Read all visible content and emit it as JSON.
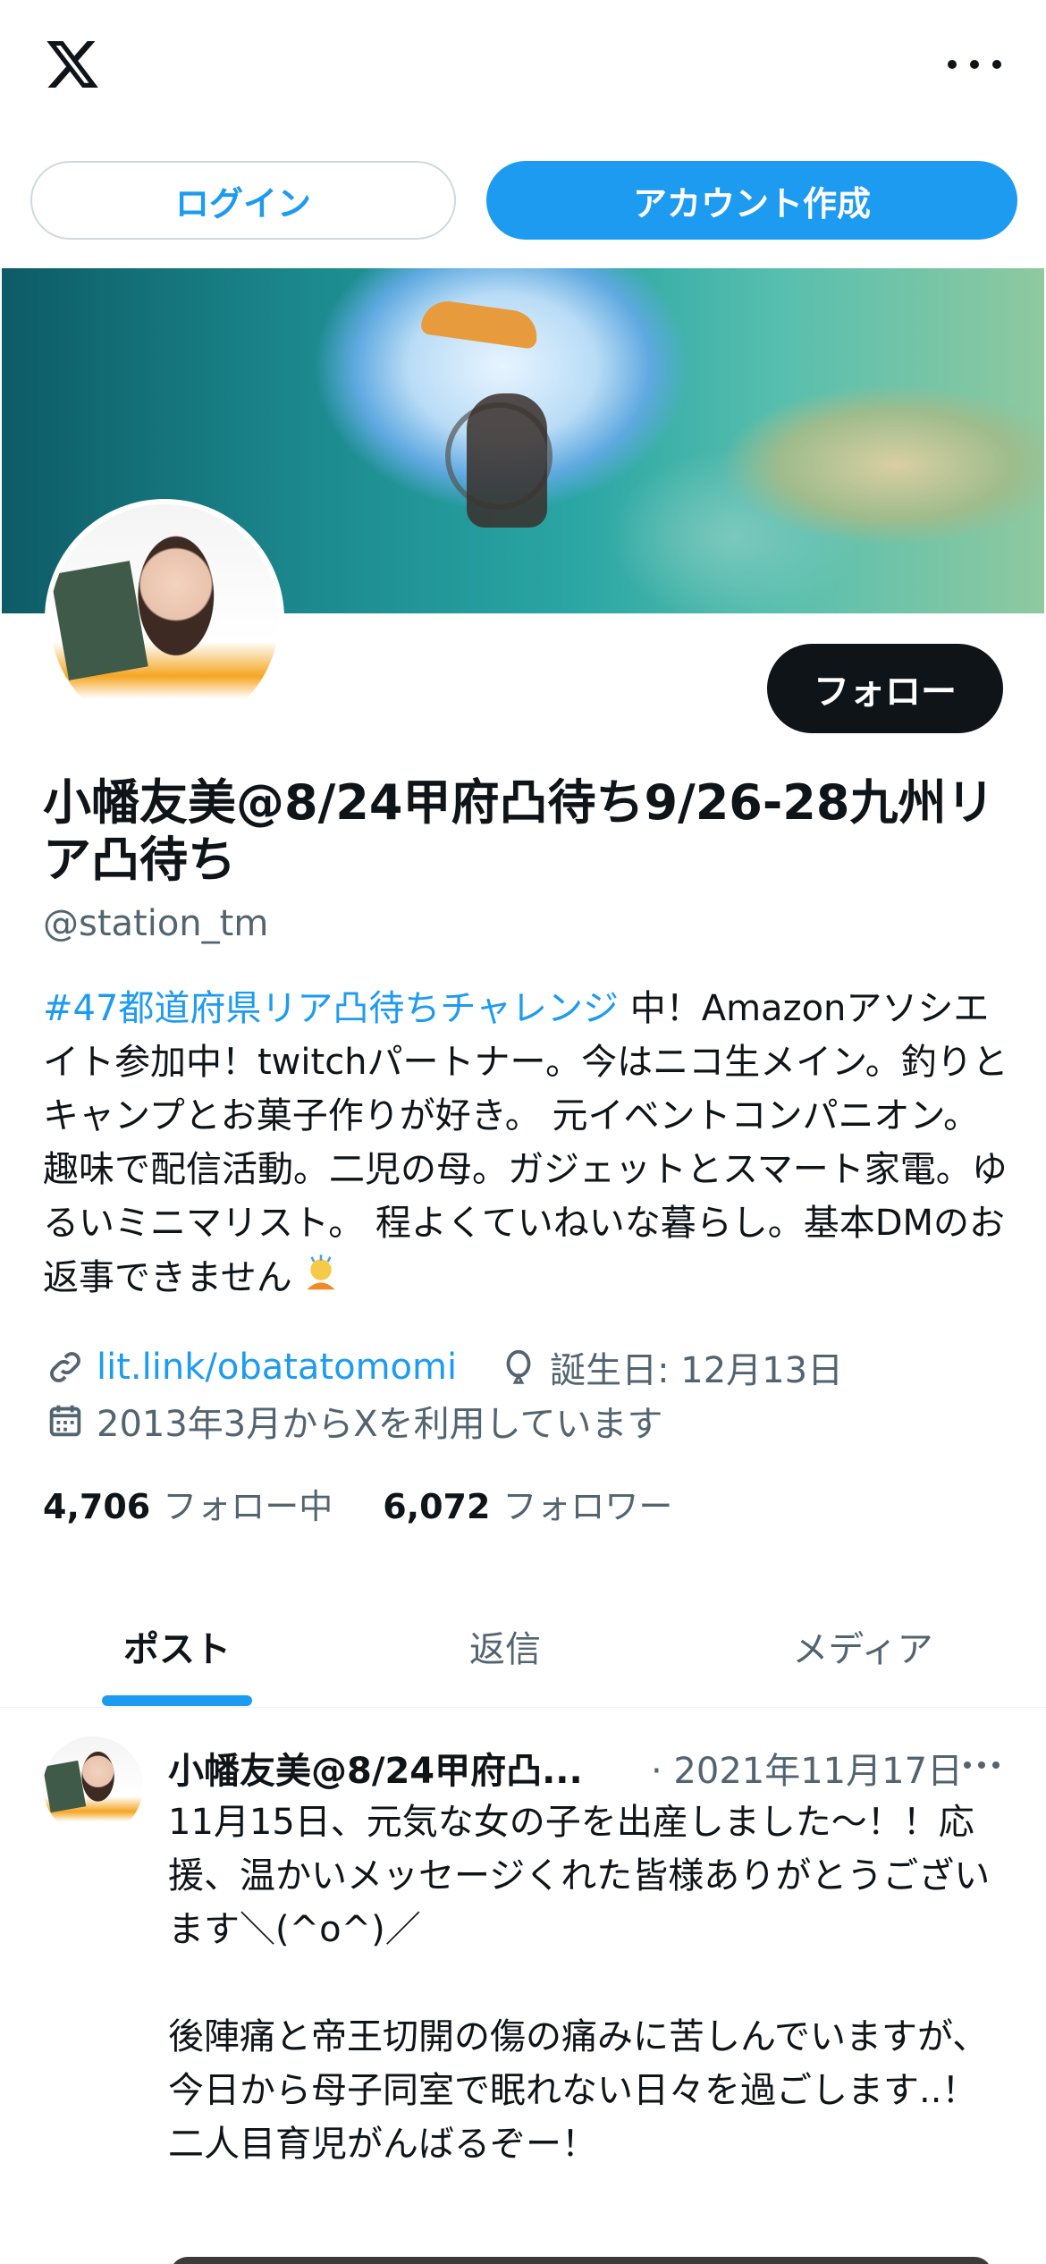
{
  "header": {
    "logo": "x-logo-icon",
    "more_icon": "more-horizontal-icon"
  },
  "auth": {
    "login_label": "ログイン",
    "signup_label": "アカウント作成"
  },
  "profile": {
    "follow_label": "フォロー",
    "display_name": "小幡友美@8/24甲府凸待ち9/26-28九州リア凸待ち",
    "handle": "@station_tm",
    "bio_hashtag": "#47都道府県リア凸待ちチャレンジ",
    "bio_text": " 中！Amazonアソシエイト参加中！twitchパートナー。今はニコ生メイン。釣りとキャンプとお菓子作りが好き。 元イベントコンパニオン。趣味で配信活動。二児の母。ガジェットとスマート家電。ゆるいミニマリスト。 程よくていねいな暮らし。基本DMのお返事できません",
    "bio_emoji": "person-bowing-emoji",
    "link": "lit.link/obatatomomi",
    "birthday": "誕生日: 12月13日",
    "joined": "2013年3月からXを利用しています",
    "following_count": "4,706",
    "following_label": "フォロー中",
    "followers_count": "6,072",
    "followers_label": "フォロワー"
  },
  "tabs": [
    {
      "label": "ポスト",
      "active": true
    },
    {
      "label": "返信",
      "active": false
    },
    {
      "label": "メディア",
      "active": false
    }
  ],
  "post": {
    "author": "小幡友美@8/24甲府凸...",
    "date": "· 2021年11月17日",
    "body": "11月15日、元気な女の子を出産しました〜！！応援、温かいメッセージくれた皆様ありがとうございます＼(^o^)／\n\n後陣痛と帝王切開の傷の痛みに苦しんでいますが、今日から母子同室で眠れない日々を過ごします..！\n二人目育児がんばるぞー！"
  },
  "colors": {
    "accent": "#1d9bf0",
    "text": "#0f1419",
    "muted": "#536471"
  }
}
